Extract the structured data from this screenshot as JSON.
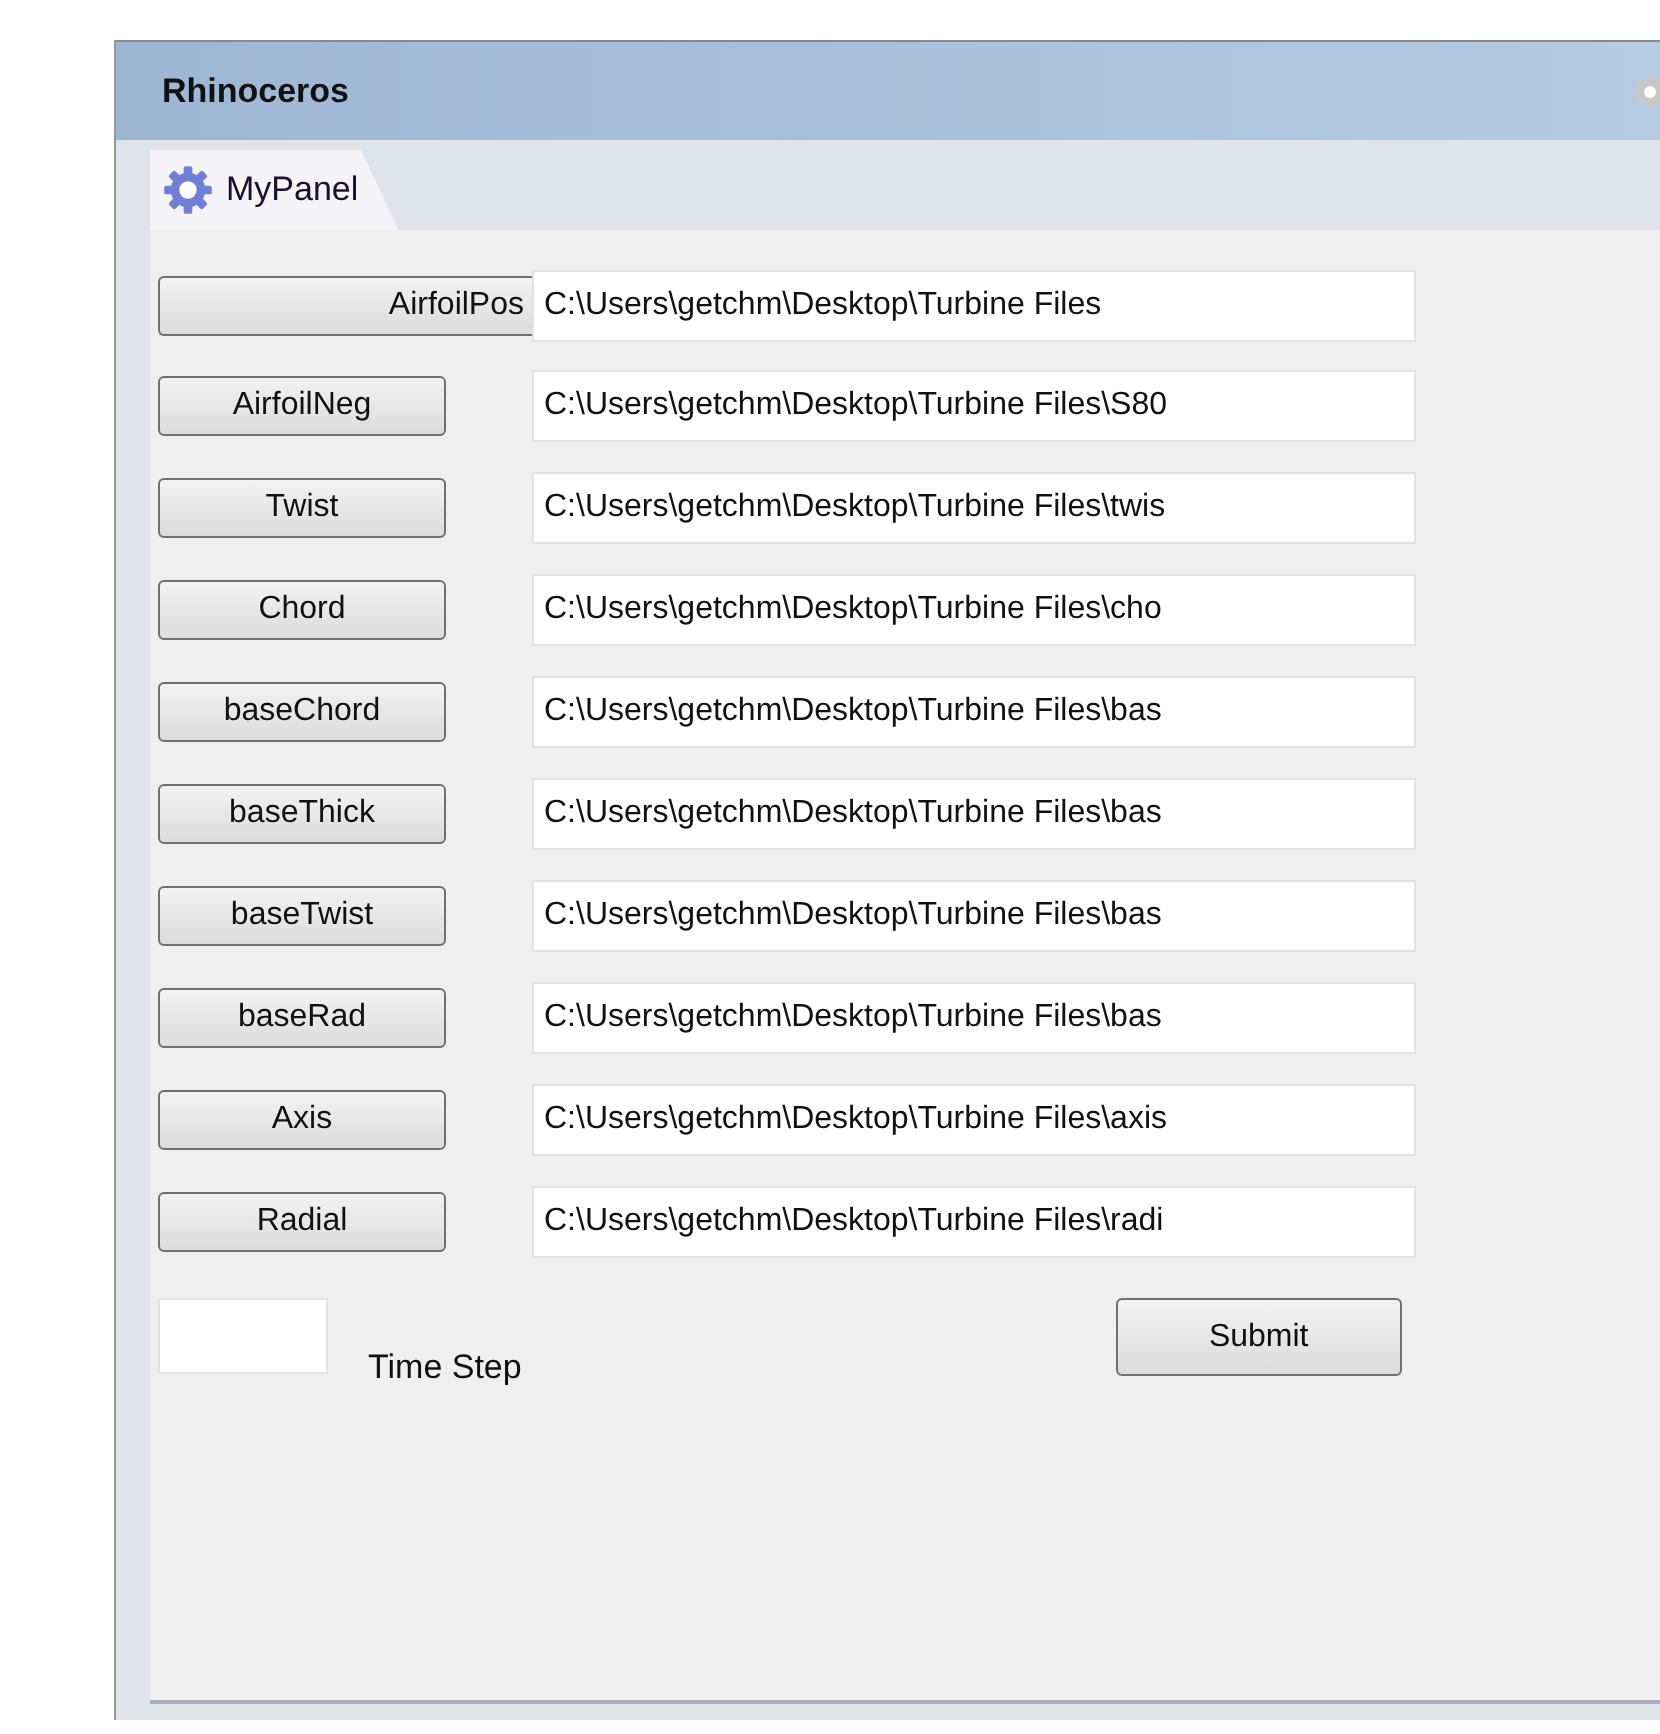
{
  "window": {
    "title": "Rhinoceros"
  },
  "tabs": [
    {
      "label": "MyPanel",
      "selected": true
    }
  ],
  "rows": [
    {
      "button": "AirfoilPos",
      "path": "C:\\Users\\getchm\\Desktop\\Turbine Files",
      "kind": "wide"
    },
    {
      "button": "AirfoilNeg",
      "path": "C:\\Users\\getchm\\Desktop\\Turbine Files\\S80",
      "kind": "normal"
    },
    {
      "button": "Twist",
      "path": "C:\\Users\\getchm\\Desktop\\Turbine Files\\twis",
      "kind": "normal"
    },
    {
      "button": "Chord",
      "path": "C:\\Users\\getchm\\Desktop\\Turbine Files\\cho",
      "kind": "normal"
    },
    {
      "button": "baseChord",
      "path": "C:\\Users\\getchm\\Desktop\\Turbine Files\\bas",
      "kind": "normal"
    },
    {
      "button": "baseThick",
      "path": "C:\\Users\\getchm\\Desktop\\Turbine Files\\bas",
      "kind": "normal"
    },
    {
      "button": "baseTwist",
      "path": "C:\\Users\\getchm\\Desktop\\Turbine Files\\bas",
      "kind": "normal"
    },
    {
      "button": "baseRad",
      "path": "C:\\Users\\getchm\\Desktop\\Turbine Files\\bas",
      "kind": "normal"
    },
    {
      "button": "Axis",
      "path": "C:\\Users\\getchm\\Desktop\\Turbine Files\\axis",
      "kind": "normal"
    },
    {
      "button": "Radial",
      "path": "C:\\Users\\getchm\\Desktop\\Turbine Files\\radi",
      "kind": "normal"
    }
  ],
  "time_step": {
    "label": "Time Step"
  },
  "submit": {
    "label": "Submit"
  }
}
